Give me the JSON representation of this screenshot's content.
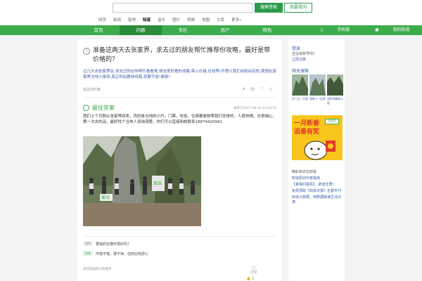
{
  "search": {
    "value": "",
    "search_button": "搜索答案",
    "ask_button": "我要提问"
  },
  "subnav": [
    "网页",
    "新闻",
    "贴吧",
    "知道",
    "音乐",
    "图片",
    "视频",
    "地图",
    "文库",
    "更多»"
  ],
  "green_nav": {
    "items": [
      "首页",
      "问题",
      "专栏",
      "用户",
      "特色"
    ],
    "right": [
      "手机版",
      "我的知道"
    ]
  },
  "question": {
    "title": "准备这两天去张家界，求去过的朋友帮忙推荐份攻略，最好是带价格的？",
    "description": "过几天去张家界玩,求去过的伙伴帮忙看看我,体验度好看的线路,带上价格,在线等!不想火我们自助出走的,我想玩张家界当地人接待,真正的玩趣味线路,就要节省!谢谢!",
    "meta": "我是你的菜",
    "action_icons": [
      "share-icon",
      "comment-icon",
      "thumb-up-icon",
      "star-icon"
    ]
  },
  "best_answer": {
    "label": "最佳答案",
    "time": "发布于2017-04-10 15:23:55",
    "text": "我们上个月刚从张家界回来，找的是当地的小丹，门票，吃饭，住宿都是她帮我们安排的，人很热情。也很细心，第一次去的话，最好找个当地人咨询清楚，你们可以直接和她联系18874420991",
    "photo_logo": "爱玩"
  },
  "followups": [
    {
      "tag": "追问",
      "text": "要钱的住宿环境好吗？"
    },
    {
      "tag": "追答",
      "text": "环境不错，很干净，住的比较舒心"
    }
  ],
  "answer_note": "本回答由提问者推荐",
  "vote": {
    "count": "评论",
    "likes": "2"
  },
  "sidebar": {
    "title": "登录",
    "text": "还没有账号吗？",
    "link": "立即注册",
    "related_title": "相关搜索",
    "thumb_captions": [
      "开门山一日游",
      "湖南十一自驾",
      "张家界森林公园"
    ],
    "ad_line1": "一月新番",
    "ad_line2": "追番有奖",
    "ad_logo": "iQIYI",
    "recommended_title": "精彩知识在知道",
    "recommended_items": [
      "知道原创作者指南",
      "【真相问答机】：辟谣优质！",
      "免费领取《知道日报》全套专刊",
      "知道大数据，用数据解读生活点滴"
    ]
  }
}
